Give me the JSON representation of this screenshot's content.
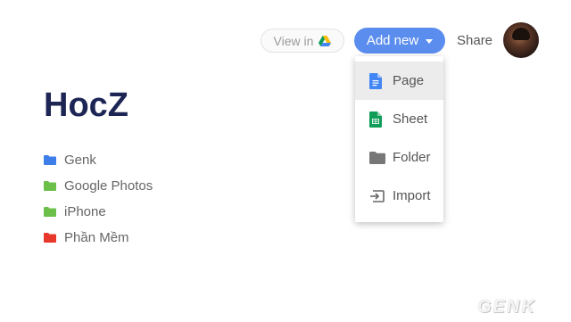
{
  "toolbar": {
    "view_in_label": "View in",
    "drive_icon": "google-drive-icon",
    "add_new_label": "Add new",
    "share_label": "Share",
    "accent_color": "#5b8dee"
  },
  "site": {
    "title": "HocZ"
  },
  "folders": [
    {
      "label": "Genk",
      "color": "#3d7ee8",
      "icon": "folder-icon"
    },
    {
      "label": "Google Photos",
      "color": "#6cc04a",
      "icon": "folder-icon"
    },
    {
      "label": "iPhone",
      "color": "#6cc04a",
      "icon": "folder-icon"
    },
    {
      "label": "Phần Mềm",
      "color": "#e8382c",
      "icon": "folder-icon"
    }
  ],
  "add_menu": {
    "items": [
      {
        "label": "Page",
        "icon": "docs-page-icon",
        "color": "#4285f4",
        "highlighted": true
      },
      {
        "label": "Sheet",
        "icon": "sheets-icon",
        "color": "#0f9d58"
      },
      {
        "label": "Folder",
        "icon": "folder-icon",
        "color": "#777777"
      },
      {
        "label": "Import",
        "icon": "import-icon",
        "color": "#666666"
      }
    ]
  },
  "watermark": {
    "text": "GENK"
  }
}
